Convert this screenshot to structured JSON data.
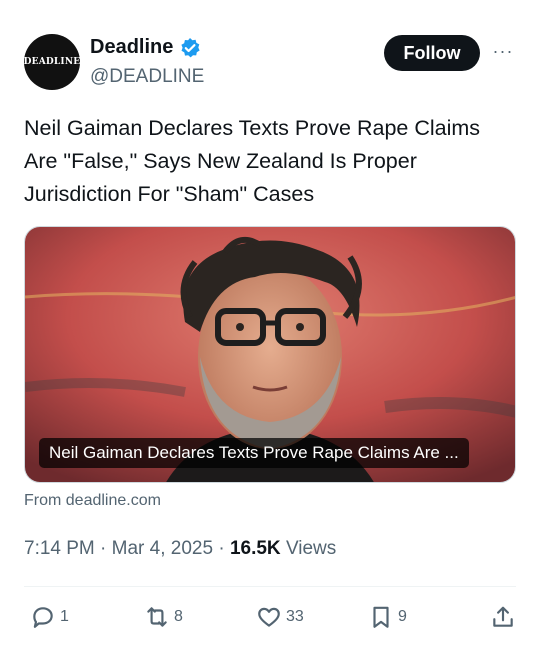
{
  "author": {
    "display_name": "Deadline",
    "handle": "@DEADLINE",
    "avatar_text": "DEADLINE",
    "verified": true
  },
  "follow_label": "Follow",
  "more_label": "···",
  "tweet_text": "Neil Gaiman Declares Texts Prove Rape Claims Are \"False,\" Says New Zealand Is Proper Jurisdiction For \"Sham\" Cases",
  "card": {
    "title": "Neil Gaiman Declares Texts Prove Rape Claims Are ...",
    "source": "From deadline.com"
  },
  "meta": {
    "time": "7:14 PM",
    "separator": "·",
    "date": "Mar 4, 2025",
    "views_count": "16.5K",
    "views_label": "Views"
  },
  "actions": {
    "replies": "1",
    "reposts": "8",
    "likes": "33",
    "bookmarks": "9"
  },
  "colors": {
    "text_primary": "#0f1419",
    "text_secondary": "#536471",
    "verified_blue": "#1d9bf0",
    "card_background": "#c9514f"
  }
}
